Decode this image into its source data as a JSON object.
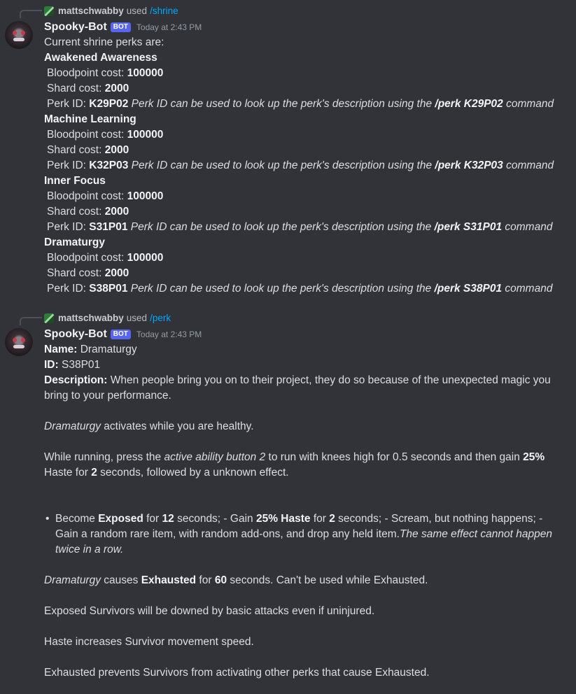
{
  "messages": [
    {
      "reply": {
        "user": "mattschwabby",
        "used": "used",
        "command": "/shrine"
      },
      "author": "Spooky-Bot",
      "badge": "BOT",
      "time": "Today at 2:43 PM",
      "intro": "Current shrine perks are:",
      "labels": {
        "bp": "Bloodpoint cost:",
        "shard": "Shard cost:",
        "pid": "Perk ID:",
        "desc_pre": "Perk ID can be used to look up the perk's description using the",
        "desc_post": "command"
      },
      "perks": [
        {
          "name": "Awakened Awareness",
          "bp": "100000",
          "shard": "2000",
          "id": "K29P02",
          "cmd": "/perk K29P02"
        },
        {
          "name": "Machine Learning",
          "bp": "100000",
          "shard": "2000",
          "id": "K32P03",
          "cmd": "/perk K32P03"
        },
        {
          "name": "Inner Focus",
          "bp": "100000",
          "shard": "2000",
          "id": "S31P01",
          "cmd": "/perk S31P01"
        },
        {
          "name": "Dramaturgy",
          "bp": "100000",
          "shard": "2000",
          "id": "S38P01",
          "cmd": "/perk S38P01"
        }
      ]
    },
    {
      "reply": {
        "user": "mattschwabby",
        "used": "used",
        "command": "/perk"
      },
      "author": "Spooky-Bot",
      "badge": "BOT",
      "time": "Today at 2:43 PM",
      "name_label": "Name:",
      "name_value": "Dramaturgy",
      "id_label": "ID:",
      "id_value": "S38P01",
      "desc_label": "Description:",
      "desc_text": "When people bring you on to their project, they do so because of the unexpected magic you bring to your performance.",
      "p1_em": "Dramaturgy",
      "p1_rest": "activates while you are healthy.",
      "p2_a": "While running, press the",
      "p2_em": "active ability button 2",
      "p2_b": "to run with knees high for 0.5 seconds and then gain",
      "p2_bold1": "25%",
      "p2_c": "Haste for",
      "p2_bold2": "2",
      "p2_d": "seconds, followed by a unknown effect.",
      "bullet": {
        "a": "Become",
        "b1": "Exposed",
        "c": "for",
        "b2": "12",
        "d": "seconds; - Gain",
        "b3": "25%",
        "b4": "Haste",
        "e": "for",
        "b5": "2",
        "f": "seconds; - Scream, but nothing happens; - Gain a random rare item, with random add-ons, and drop any held item.",
        "em": "The same effect cannot happen twice in a row."
      },
      "p3_em": "Dramaturgy",
      "p3_a": "causes",
      "p3_b1": "Exhausted",
      "p3_c": "for",
      "p3_b2": "60",
      "p3_d": "seconds. Can't be used while Exhausted.",
      "p4": "Exposed Survivors will be downed by basic attacks even if uninjured.",
      "p5": "Haste increases Survivor movement speed.",
      "p6": "Exhausted prevents Survivors from activating other perks that cause Exhausted."
    }
  ]
}
